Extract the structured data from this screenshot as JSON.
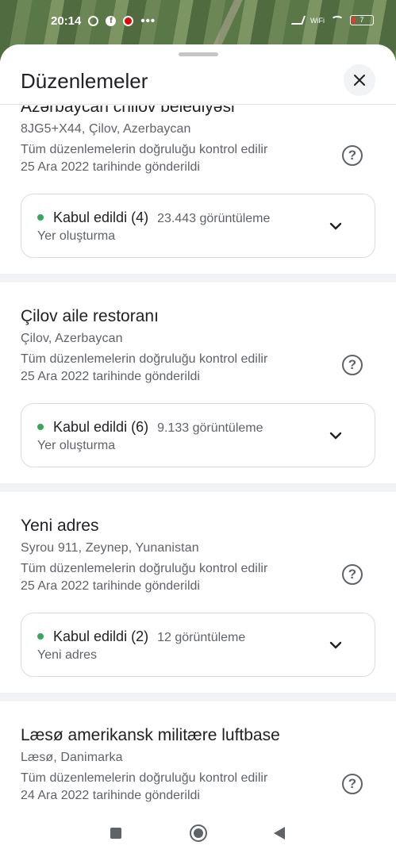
{
  "status_bar": {
    "time": "20:14",
    "notification_icons": [
      "opera-icon",
      "facebook-icon",
      "vodafone-icon"
    ],
    "more": "•••",
    "wifi_label": "WiFi",
    "battery": "7"
  },
  "sheet": {
    "title": "Düzenlemeler",
    "close_icon": "close-icon"
  },
  "edits": [
    {
      "name": "Azərbaycan chilov belediyəsi",
      "address": "8JG5+X44, Çilov, Azerbaycan",
      "verify_line1": "Tüm düzenlemelerin doğruluğu kontrol edilir",
      "verify_line2": "25 Ara 2022 tarihinde gönderildi",
      "status": "Kabul edildi (4)",
      "views": "23.443 görüntüleme",
      "type": "Yer oluşturma"
    },
    {
      "name": "Çilov aile restoranı",
      "address": "Çilov, Azerbaycan",
      "verify_line1": "Tüm düzenlemelerin doğruluğu kontrol edilir",
      "verify_line2": "25 Ara 2022 tarihinde gönderildi",
      "status": "Kabul edildi (6)",
      "views": "9.133 görüntüleme",
      "type": "Yer oluşturma"
    },
    {
      "name": "Yeni adres",
      "address": "Syrou 911, Zeynep, Yunanistan",
      "verify_line1": "Tüm düzenlemelerin doğruluğu kontrol edilir",
      "verify_line2": "25 Ara 2022 tarihinde gönderildi",
      "status": "Kabul edildi (2)",
      "views": "12 görüntüleme",
      "type": "Yeni adres"
    },
    {
      "name": "Læsø amerikansk militære luftbase",
      "address": "Læsø, Danimarka",
      "verify_line1": "Tüm düzenlemelerin doğruluğu kontrol edilir",
      "verify_line2": "24 Ara 2022 tarihinde gönderildi"
    }
  ],
  "colors": {
    "accepted_dot": "#34a853",
    "text_primary": "#202124",
    "text_secondary": "#5f6368"
  },
  "navbar": {
    "icons": [
      "recents-square-icon",
      "home-circle-icon",
      "back-triangle-icon"
    ]
  }
}
